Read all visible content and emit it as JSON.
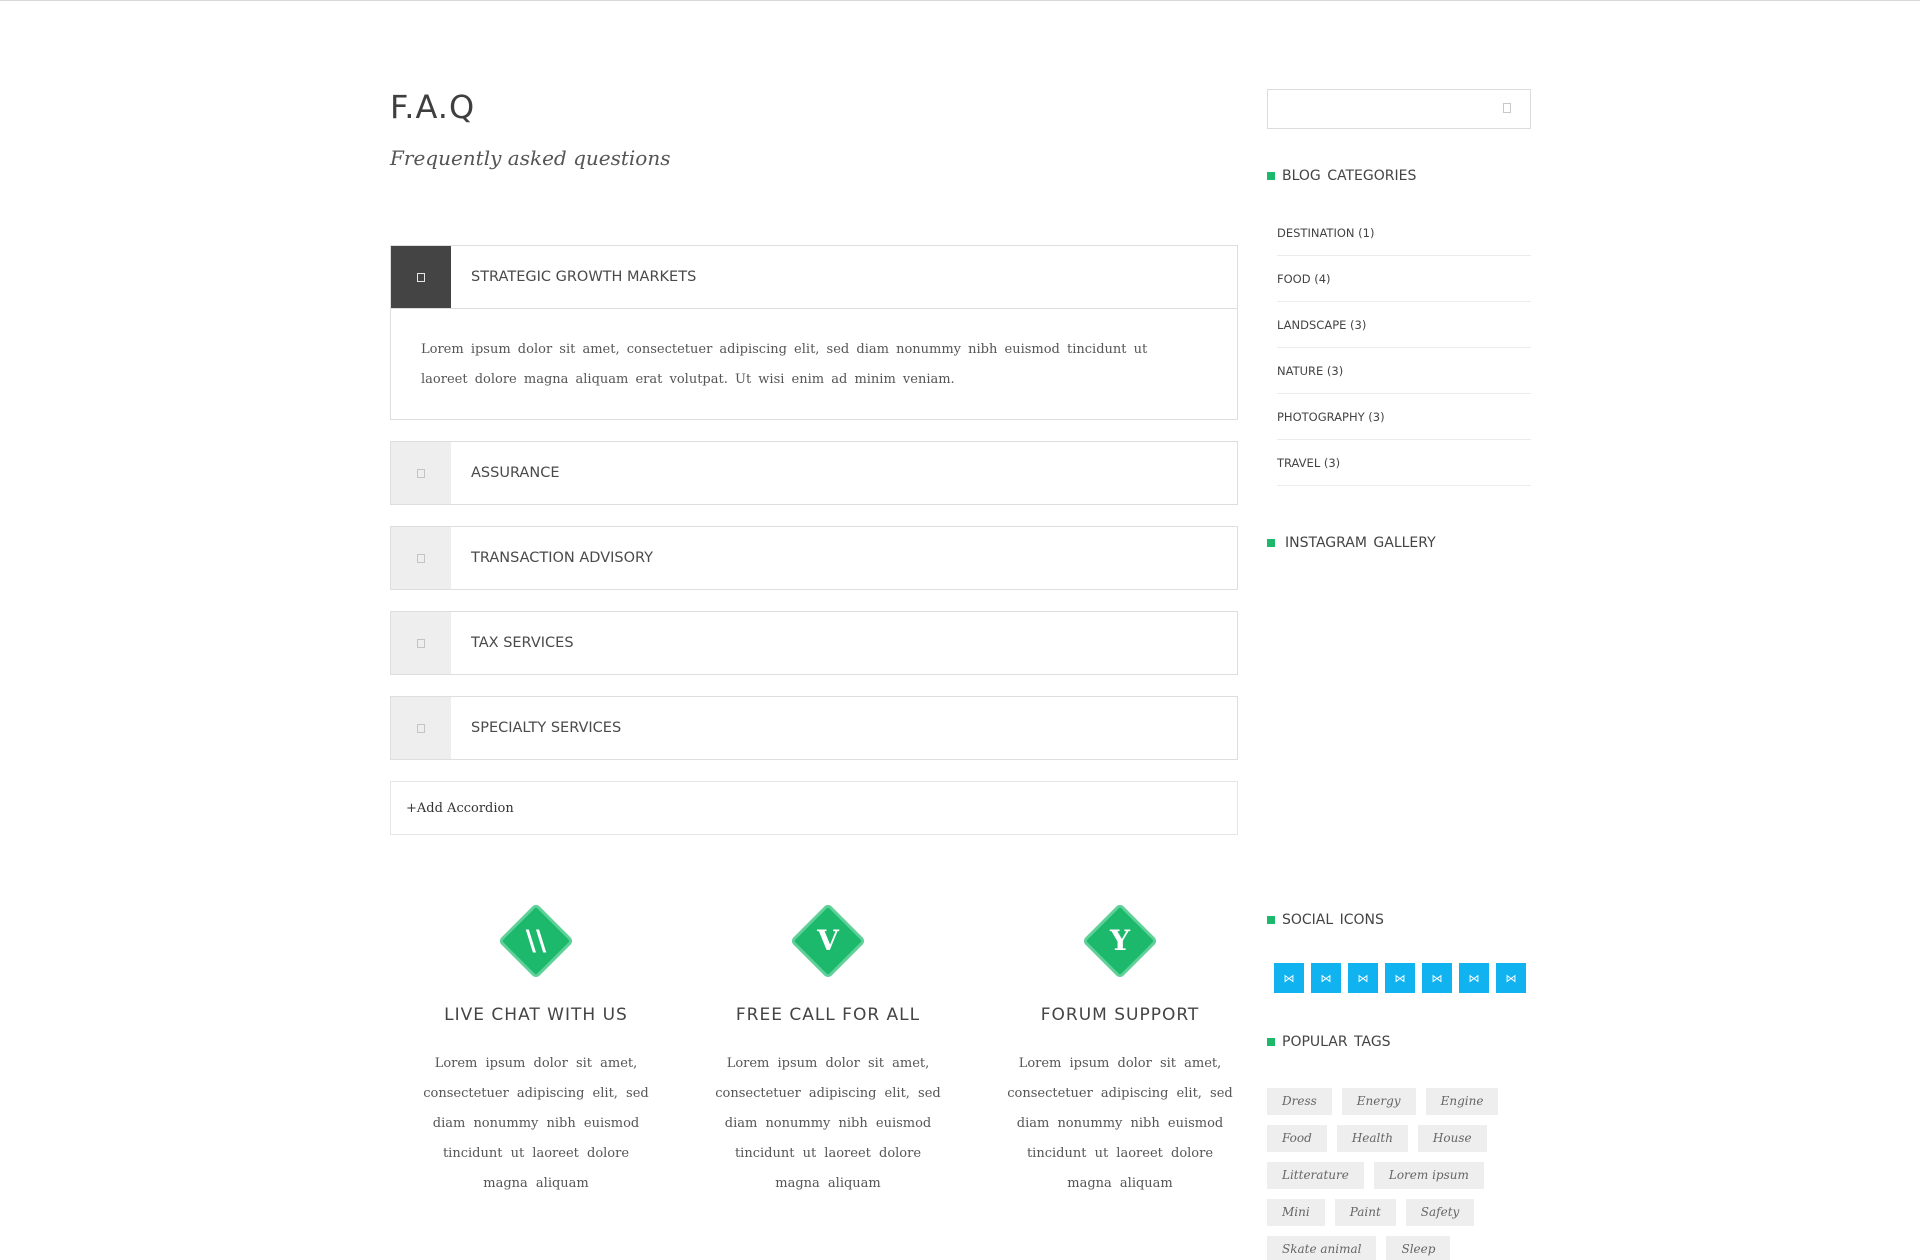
{
  "page": {
    "title": "F.A.Q",
    "subtitle": "Frequently asked questions"
  },
  "accordion": {
    "items": [
      {
        "title": "STRATEGIC GROWTH MARKETS",
        "open": true,
        "body": "Lorem ipsum dolor sit amet, consectetuer adipiscing elit, sed diam nonummy nibh euismod tincidunt ut laoreet dolore magna aliquam erat volutpat. Ut wisi enim ad minim veniam."
      },
      {
        "title": "ASSURANCE",
        "open": false
      },
      {
        "title": "TRANSACTION ADVISORY",
        "open": false
      },
      {
        "title": "TAX SERVICES",
        "open": false
      },
      {
        "title": "SPECIALTY SERVICES",
        "open": false
      }
    ],
    "add_label": "+Add Accordion"
  },
  "features": [
    {
      "glyph": "\\\\",
      "title": "LIVE CHAT WITH US",
      "text": "Lorem ipsum dolor sit amet, consectetuer adipiscing elit, sed diam nonummy nibh euismod tincidunt ut laoreet dolore magna aliquam"
    },
    {
      "glyph": "V",
      "title": "FREE CALL FOR ALL",
      "text": "Lorem ipsum dolor sit amet, consectetuer adipiscing elit, sed diam nonummy nibh euismod tincidunt ut laoreet dolore magna aliquam"
    },
    {
      "glyph": "Y",
      "title": "FORUM SUPPORT",
      "text": "Lorem ipsum dolor sit amet, consectetuer adipiscing elit, sed diam nonummy nibh euismod tincidunt ut laoreet dolore magna aliquam"
    }
  ],
  "sidebar": {
    "search": {
      "value": "",
      "placeholder": "",
      "icon": "search-icon"
    },
    "blog_categories": {
      "title": "BLOG CATEGORIES",
      "items": [
        {
          "label": "DESTINATION (1)"
        },
        {
          "label": "FOOD (4)"
        },
        {
          "label": "LANDSCAPE (3)"
        },
        {
          "label": "NATURE (3)"
        },
        {
          "label": "PHOTOGRAPHY (3)"
        },
        {
          "label": "TRAVEL (3)"
        }
      ]
    },
    "instagram": {
      "title": "INSTAGRAM GALLERY"
    },
    "social": {
      "title": "SOCIAL ICONS",
      "icons": [
        "social-icon",
        "social-icon",
        "social-icon",
        "social-icon",
        "social-icon",
        "social-icon",
        "social-icon"
      ],
      "glyph": "⋈"
    },
    "popular_tags": {
      "title": "POPULAR TAGS",
      "tags": [
        "Dress",
        "Energy",
        "Engine",
        "Food",
        "Health",
        "House",
        "Litterature",
        "Lorem ipsum",
        "Mini",
        "Paint",
        "Safety",
        "Skate animal",
        "Sleep"
      ]
    }
  },
  "colors": {
    "accent_green": "#1cb86b",
    "social_blue": "#10b3f0",
    "toggle_active": "#444444",
    "toggle_inactive": "#eeeeee"
  }
}
